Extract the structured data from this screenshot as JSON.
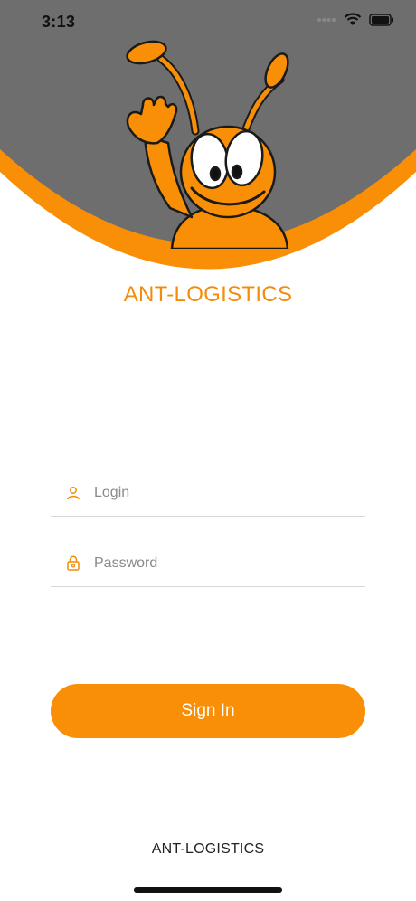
{
  "status_bar": {
    "time": "3:13"
  },
  "brand": {
    "title": "ANT-LOGISTICS",
    "footer": "ANT-LOGISTICS"
  },
  "form": {
    "login_placeholder": "Login",
    "password_placeholder": "Password",
    "signin_label": "Sign In"
  },
  "colors": {
    "accent": "#f98f06",
    "header_gray": "#6e6e6e"
  },
  "icons": {
    "mascot": "ant-mascot-illustration",
    "login": "user-icon",
    "password": "lock-icon"
  }
}
